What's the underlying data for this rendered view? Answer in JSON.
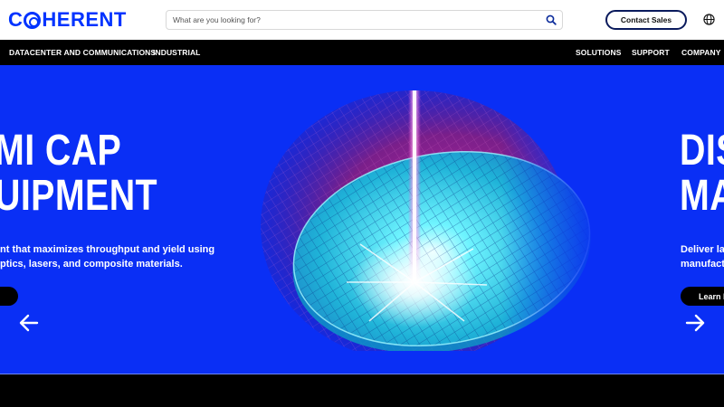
{
  "header": {
    "logo_text": "COHERENT",
    "search_placeholder": "What are you looking for?",
    "contact_label": "Contact Sales"
  },
  "nav": {
    "left": [
      "DATACENTER AND COMMUNICATIONS",
      "INDUSTRIAL"
    ],
    "right": [
      "SOLUTIONS",
      "SUPPORT",
      "COMPANY"
    ]
  },
  "hero": {
    "slide_left": {
      "headline_line1": "MI CAP",
      "headline_line2": "UIPMENT",
      "desc_line1": "nt that maximizes throughput and yield using",
      "desc_line2": "ptics, lasers, and composite materials."
    },
    "slide_right": {
      "headline_line1": "DIS",
      "headline_line2": "MA",
      "desc_line1": "Deliver las",
      "desc_line2": "manufactu",
      "button_label": "Learn M"
    }
  },
  "colors": {
    "brand_blue": "#0033ff",
    "hero_blue": "#0a2ff5",
    "nav_black": "#000000"
  },
  "icons": [
    "search-icon",
    "globe-icon",
    "arrow-left-icon",
    "arrow-right-icon"
  ]
}
